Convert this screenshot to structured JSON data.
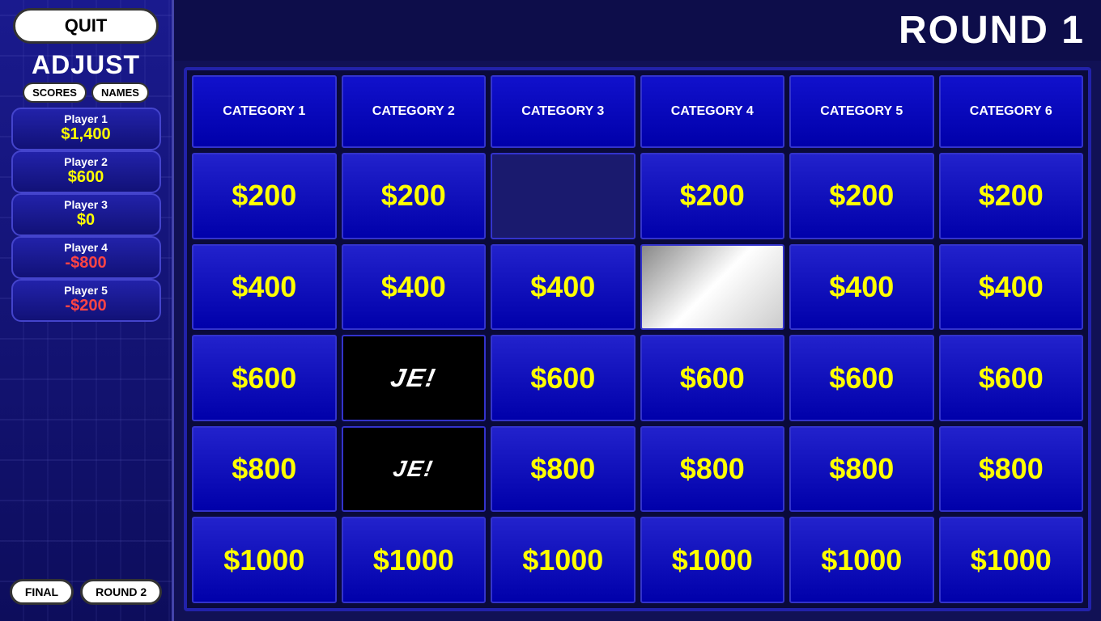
{
  "sidebar": {
    "quit_label": "QUIT",
    "adjust_label": "ADJUST",
    "scores_label": "SCORES",
    "names_label": "NAMES",
    "players": [
      {
        "name": "Player 1",
        "score": "$1,400",
        "negative": false
      },
      {
        "name": "Player 2",
        "score": "$600",
        "negative": false
      },
      {
        "name": "Player 3",
        "score": "$0",
        "negative": false
      },
      {
        "name": "Player 4",
        "score": "-$800",
        "negative": true
      },
      {
        "name": "Player 5",
        "score": "-$200",
        "negative": true
      }
    ],
    "final_label": "FINAL",
    "round2_label": "ROUND 2"
  },
  "header": {
    "round_title": "ROUND 1"
  },
  "board": {
    "categories": [
      "CATEGORY 1",
      "CATEGORY 2",
      "CATEGORY 3",
      "CATEGORY 4",
      "CATEGORY 5",
      "CATEGORY 6"
    ],
    "rows": [
      {
        "values": [
          "$200",
          "$200",
          null,
          "$200",
          "$200",
          "$200"
        ],
        "revealed": [
          false,
          false,
          "dark",
          false,
          false,
          false
        ]
      },
      {
        "values": [
          "$400",
          "$400",
          "$400",
          null,
          "$400",
          "$400"
        ],
        "revealed": [
          false,
          false,
          false,
          "image1",
          false,
          false
        ]
      },
      {
        "values": [
          "$600",
          null,
          "$600",
          "$600",
          "$600",
          "$600"
        ],
        "revealed": [
          false,
          "jeopardy1",
          false,
          false,
          false,
          false
        ]
      },
      {
        "values": [
          "$800",
          null,
          "$800",
          "$800",
          "$800",
          "$800"
        ],
        "revealed": [
          false,
          "jeopardy2",
          false,
          false,
          false,
          false
        ]
      },
      {
        "values": [
          "$1000",
          "$1000",
          "$1000",
          "$1000",
          "$1000",
          "$1000"
        ],
        "revealed": [
          false,
          false,
          false,
          false,
          false,
          false
        ]
      }
    ]
  }
}
